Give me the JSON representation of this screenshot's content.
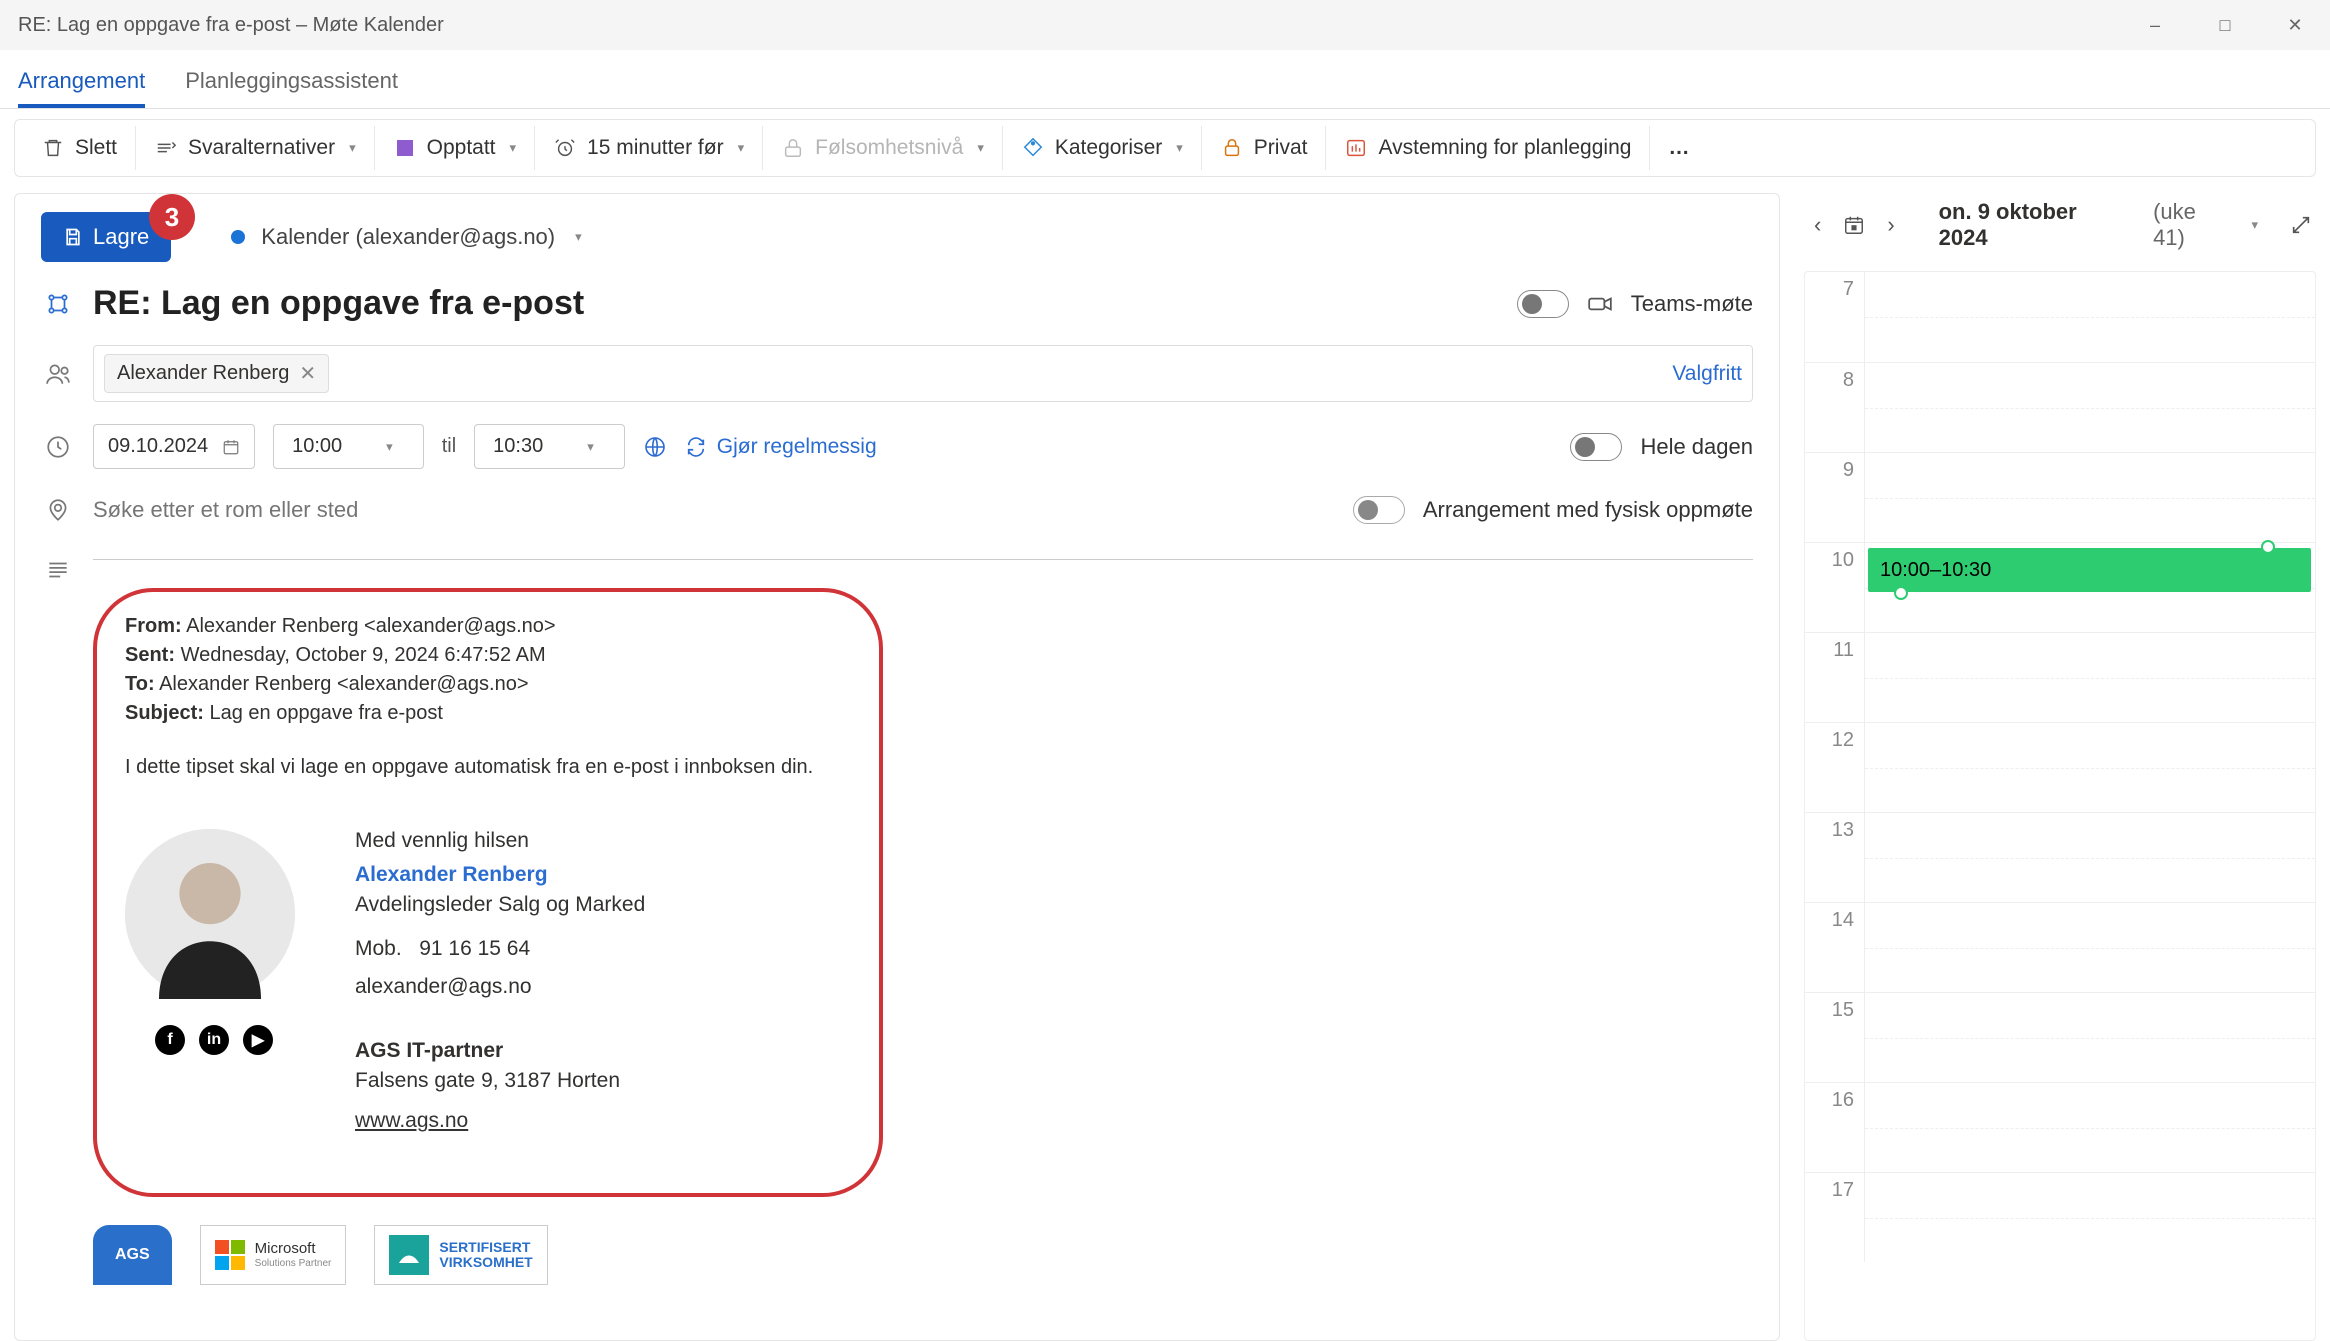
{
  "window": {
    "title": "RE: Lag en oppgave fra e-post – Møte Kalender"
  },
  "tabs": {
    "arrangement": "Arrangement",
    "assistant": "Planleggingsassistent"
  },
  "ribbon": {
    "delete": "Slett",
    "response": "Svaralternativer",
    "busy": "Opptatt",
    "reminder": "15 minutter før",
    "sensitivity": "Følsomhetsnivå",
    "categorize": "Kategoriser",
    "private": "Privat",
    "poll": "Avstemning for planlegging"
  },
  "form": {
    "save": "Lagre",
    "badge": "3",
    "calendar_label": "Kalender (alexander@ags.no)",
    "subject": "RE: Lag en oppgave fra e-post",
    "teams_label": "Teams-møte",
    "attendee": "Alexander Renberg",
    "optional": "Valgfritt",
    "date": "09.10.2024",
    "start": "10:00",
    "to_label": "til",
    "end": "10:30",
    "recurring": "Gjør regelmessig",
    "allday": "Hele dagen",
    "location_placeholder": "Søke etter et rom eller sted",
    "inperson": "Arrangement med fysisk oppmøte"
  },
  "body": {
    "from_label": "From:",
    "from": "Alexander Renberg <alexander@ags.no>",
    "sent_label": "Sent:",
    "sent": "Wednesday, October 9, 2024 6:47:52 AM",
    "to_label": "To:",
    "to": "Alexander Renberg <alexander@ags.no>",
    "subject_label": "Subject:",
    "subject": "Lag en oppgave fra e-post",
    "content": "I dette tipset skal vi lage en oppgave automatisk fra en e-post i innboksen din.",
    "sig": {
      "greeting": "Med vennlig hilsen",
      "name": "Alexander Renberg",
      "title": "Avdelingsleder Salg og Marked",
      "mob_label": "Mob.",
      "mob": "91 16 15 64",
      "email": "alexander@ags.no",
      "company": "AGS IT-partner",
      "address": "Falsens gate 9, 3187 Horten",
      "url": "www.ags.no"
    },
    "logos": {
      "ags": "AGS",
      "ms": "Microsoft",
      "ms2": "Solutions Partner",
      "sert1": "SERTIFISERT",
      "sert2": "VIRKSOMHET"
    }
  },
  "sidebar": {
    "date": "on. 9 oktober 2024",
    "week": "(uke 41)",
    "hours": [
      "7",
      "8",
      "9",
      "10",
      "11",
      "12",
      "13",
      "14",
      "15",
      "16",
      "17"
    ],
    "event": "10:00–10:30"
  }
}
